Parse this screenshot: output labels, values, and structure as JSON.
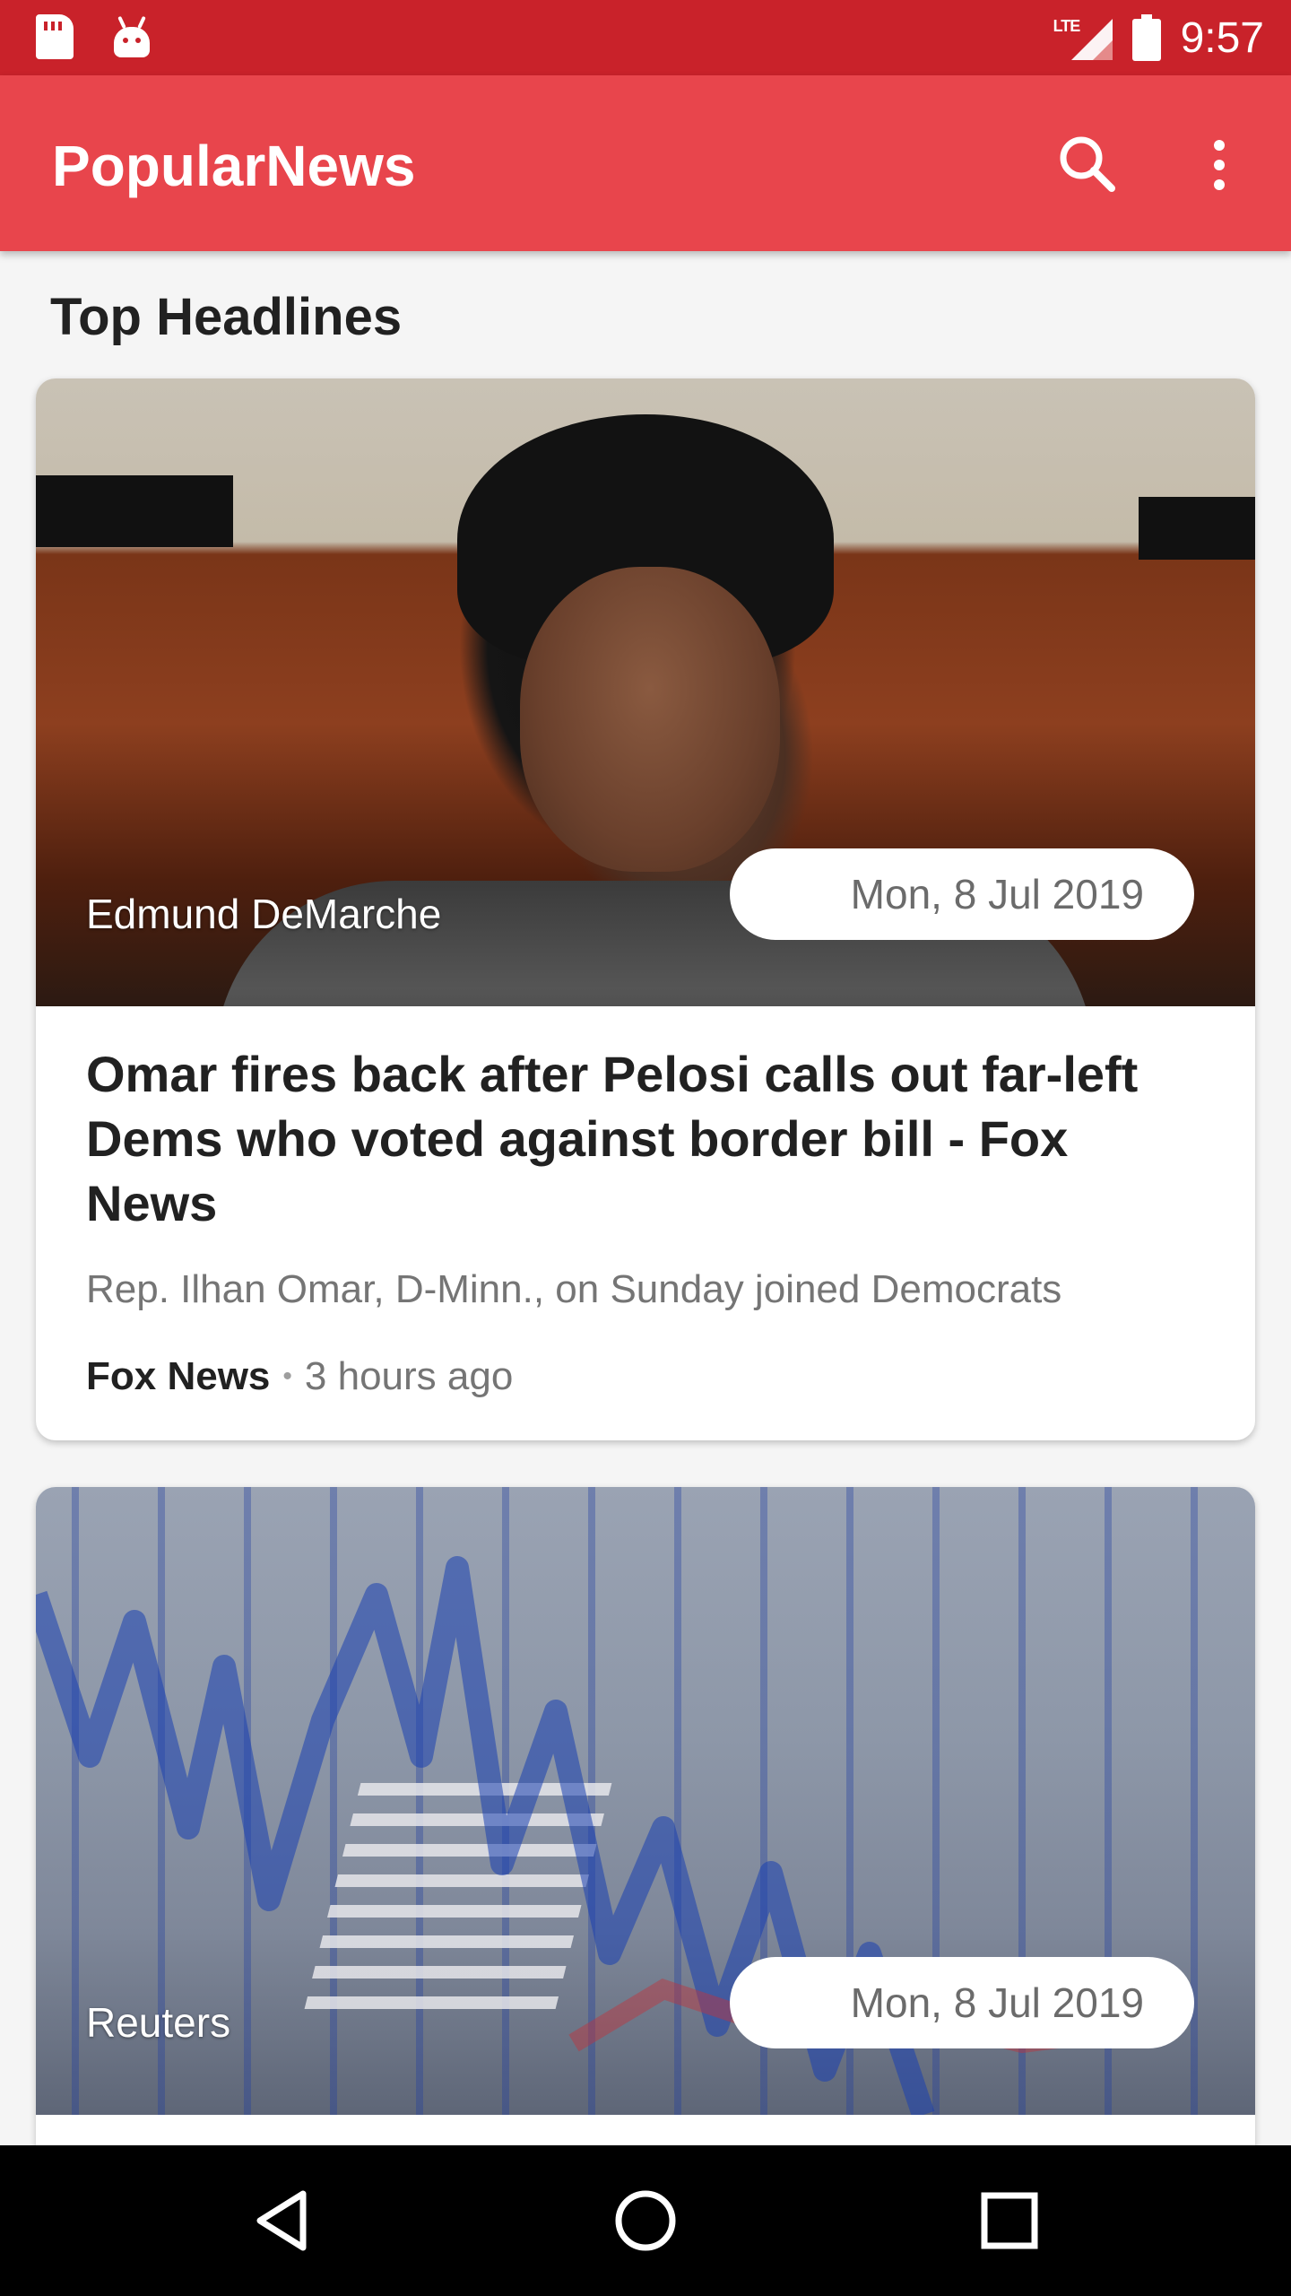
{
  "status_bar": {
    "network": "LTE",
    "time": "9:57",
    "icons": [
      "sd-card-icon",
      "android-icon",
      "signal-icon",
      "battery-icon"
    ]
  },
  "app_bar": {
    "title": "PopularNews",
    "icons": [
      "search-icon",
      "more-vert-icon"
    ]
  },
  "section": {
    "title": "Top Headlines"
  },
  "articles": [
    {
      "author": "Edmund DeMarche",
      "date": "Mon, 8 Jul 2019",
      "title": "Omar fires back after Pelosi calls out far-left Dems who voted against border bill - Fox News",
      "description": "Rep. Ilhan Omar, D-Minn., on Sunday joined Democrats",
      "source": "Fox News",
      "time_ago": "3 hours ago"
    },
    {
      "author": "Reuters",
      "date": "Mon, 8 Jul 2019"
    }
  ],
  "nav_bar": {
    "icons": [
      "back-icon",
      "home-icon",
      "recents-icon"
    ]
  },
  "colors": {
    "status_bar": "#c9222a",
    "app_bar": "#e8454c",
    "background": "#f5f5f5",
    "nav_bar": "#000000"
  }
}
